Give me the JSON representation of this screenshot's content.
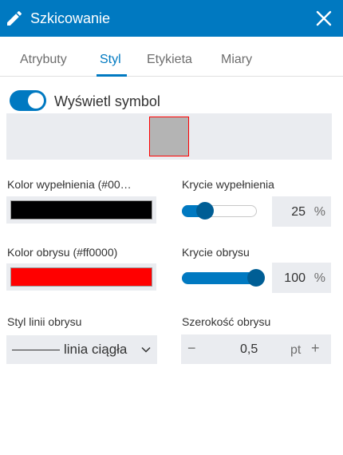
{
  "header": {
    "title": "Szkicowanie",
    "color": "#0079c1"
  },
  "tabs": [
    {
      "label": "Atrybuty",
      "active": false
    },
    {
      "label": "Styl",
      "active": true
    },
    {
      "label": "Etykieta",
      "active": false
    },
    {
      "label": "Miary",
      "active": false
    }
  ],
  "display_symbol": {
    "label": "Wyświetl symbol",
    "checked": true
  },
  "symbol_preview": {
    "fill_color": "#b4b4b4",
    "outline_color": "#ff0000"
  },
  "fill_color": {
    "label": "Kolor wypełnienia (#00…",
    "color": "#000000"
  },
  "fill_opacity": {
    "label": "Krycie wypełnienia",
    "value": "25",
    "unit": "%",
    "level_percent": 25
  },
  "outline_color": {
    "label": "Kolor obrysu (#ff0000)",
    "color": "#ff0000"
  },
  "outline_opacity": {
    "label": "Krycie obrysu",
    "value": "100",
    "unit": "%",
    "level_percent": 100
  },
  "outline_style": {
    "label": "Styl linii obrysu",
    "value": "linia ciągła"
  },
  "outline_width": {
    "label": "Szerokość obrysu",
    "value": "0,5",
    "unit": "pt",
    "minus": "−",
    "plus": "+"
  },
  "icons": {
    "header": "pencil-icon",
    "close": "close-icon",
    "dropdown": "chevron-down-icon"
  }
}
